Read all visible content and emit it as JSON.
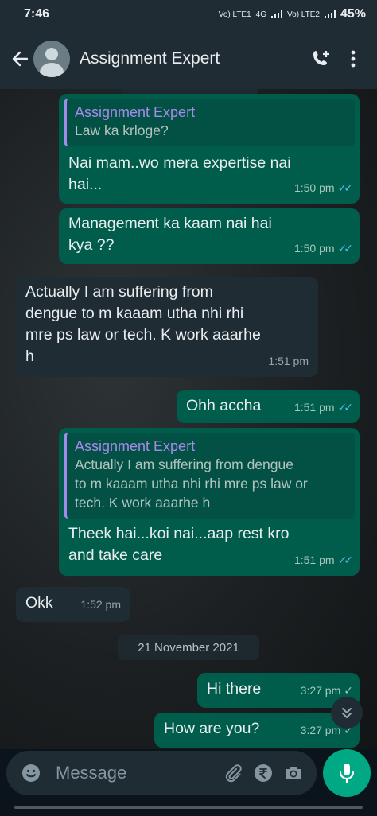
{
  "status_bar": {
    "time": "7:46",
    "battery": "45%",
    "network_labels": [
      "Vo) LTE1",
      "4G",
      "Vo) LTE2"
    ]
  },
  "header": {
    "contact_name": "Assignment Expert",
    "icons": [
      "back-arrow-icon",
      "avatar",
      "add-call-icon",
      "more-vertical-icon"
    ]
  },
  "messages": [
    {
      "dir": "out",
      "quote_name": "Assignment Expert",
      "quote_text": "Law ka krloge?",
      "text_lines": [
        "Nai mam..wo mera expertise nai",
        "hai..."
      ],
      "time": "1:50 pm",
      "status": "read"
    },
    {
      "dir": "out",
      "text_lines": [
        "Management ka kaam nai hai",
        "kya ??"
      ],
      "time": "1:50 pm",
      "status": "read"
    },
    {
      "dir": "in",
      "text_lines": [
        "Actually I am suffering from",
        "dengue to m kaaam utha nhi rhi",
        "mre ps law or tech. K work aaarhe",
        "h"
      ],
      "time": "1:51 pm"
    },
    {
      "dir": "out",
      "text_lines": [
        "Ohh accha"
      ],
      "time": "1:51 pm",
      "status": "read"
    },
    {
      "dir": "out",
      "quote_name": "Assignment Expert",
      "quote_text_lines": [
        "Actually I am suffering from dengue",
        "to m kaaam utha nhi rhi mre ps law or",
        "tech. K work aaarhe h"
      ],
      "text_lines": [
        "Theek hai...koi nai...aap rest kro",
        "and take care"
      ],
      "time": "1:51 pm",
      "status": "read"
    },
    {
      "dir": "in",
      "text_lines": [
        "Okk"
      ],
      "time": "1:52 pm"
    },
    {
      "dir": "out",
      "text_lines": [
        "Hi there"
      ],
      "time": "3:27 pm",
      "status": "sent"
    },
    {
      "dir": "out",
      "text_lines": [
        "How are you?"
      ],
      "time": "3:27 pm",
      "status": "sent"
    }
  ],
  "date_chip": "21 November 2021",
  "composer": {
    "placeholder": "Message",
    "icons": [
      "emoji-icon",
      "attach-icon",
      "rupee-payment-icon",
      "camera-icon",
      "mic-icon"
    ]
  },
  "colors": {
    "outgoing_bubble": "#005c4b",
    "incoming_bubble": "#1f2c33",
    "quote_accent": "#a58ae9",
    "read_ticks": "#53bdeb",
    "mic_button": "#00a884"
  }
}
